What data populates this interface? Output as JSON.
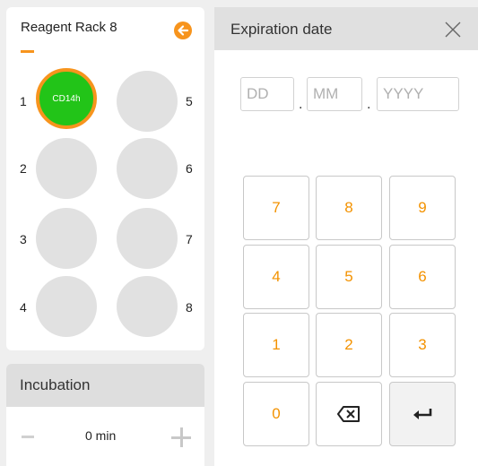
{
  "rack": {
    "title": "Reagent Rack 8",
    "positions": [
      {
        "num": "1",
        "label": "CD14h"
      },
      {
        "num": "2",
        "label": ""
      },
      {
        "num": "3",
        "label": ""
      },
      {
        "num": "4",
        "label": ""
      },
      {
        "num": "5",
        "label": ""
      },
      {
        "num": "6",
        "label": ""
      },
      {
        "num": "7",
        "label": ""
      },
      {
        "num": "8",
        "label": ""
      }
    ]
  },
  "incubation": {
    "title": "Incubation",
    "value": "0 min"
  },
  "dialog": {
    "title": "Expiration date",
    "fields": {
      "day_placeholder": "DD",
      "month_placeholder": "MM",
      "year_placeholder": "YYYY",
      "separator": "."
    },
    "keys": [
      "7",
      "8",
      "9",
      "4",
      "5",
      "6",
      "1",
      "2",
      "3",
      "0"
    ]
  },
  "colors": {
    "accent": "#f7941d",
    "slot_filled": "#22c418",
    "slot_empty": "#e1e1e1",
    "key_text": "#f39200"
  },
  "icons": {
    "back": "arrow-left-circle-icon",
    "close": "close-icon",
    "backspace": "backspace-icon",
    "enter": "enter-icon"
  }
}
